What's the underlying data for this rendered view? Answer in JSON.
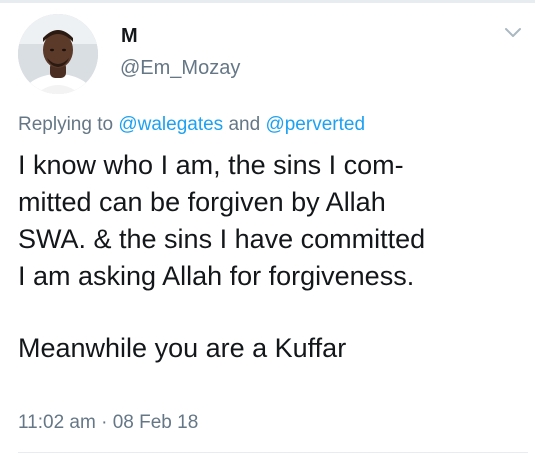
{
  "user": {
    "display_name": "M",
    "handle": "@Em_Mozay"
  },
  "reply": {
    "prefix": "Replying to",
    "mention_1": "@walegates",
    "conjunction": "and",
    "mention_2": "@perverted"
  },
  "tweet": {
    "lines": [
      "I know who I am, the sins I com-",
      "mitted can be forgiven by Allah",
      "SWA. & the sins I have committed",
      "I am asking Allah for forgiveness."
    ],
    "final_line": "Meanwhile you are a Kuffar"
  },
  "meta": {
    "time": "11:02 am",
    "separator": "·",
    "date": "08 Feb 18"
  },
  "icons": {
    "avatar": "avatar",
    "menu": "chevron-down-icon"
  },
  "colors": {
    "link": "#1da1f2",
    "secondary_text": "#657786",
    "primary_text": "#14171a",
    "divider": "#e6ecf0"
  }
}
